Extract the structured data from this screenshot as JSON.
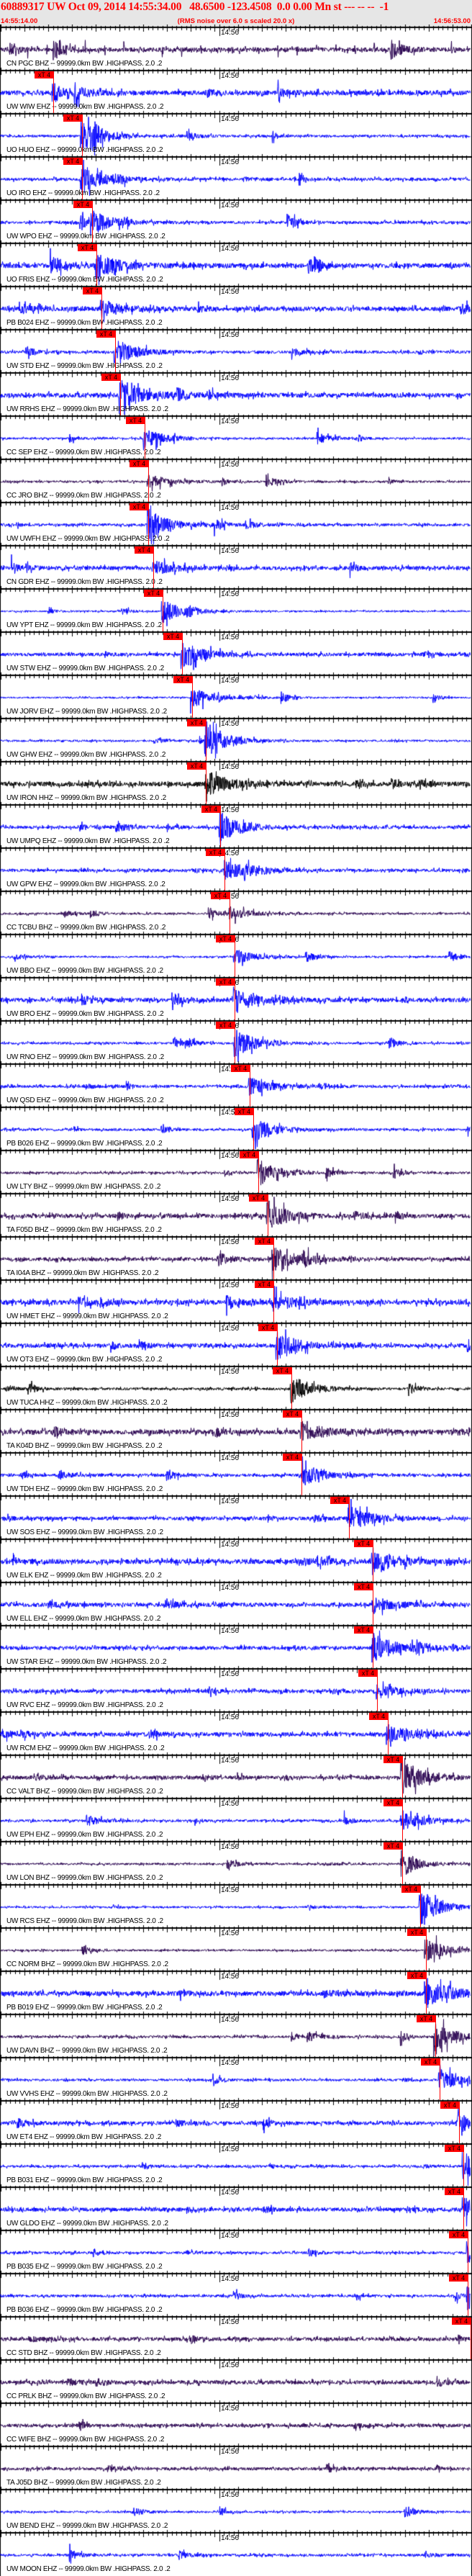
{
  "header": {
    "title": "60889317 UW Oct 09, 2014 14:55:34.00   48.6500 -123.4508  0.0 0.00 Mn st --- -- --  -1",
    "start_time": "14:55:14.00",
    "rms_note": "(RMS noise over 6.0 s scaled 20.0 x)",
    "end_time": "14:56:53.00"
  },
  "axis": {
    "minute_label": "14:56",
    "minute_offset_s": 46,
    "duration_s": 99
  },
  "pick_label": "xT 4",
  "colors": {
    "EHZ": "#0000ff",
    "BHZ": "#28004f",
    "HHZ": "#000000",
    "pick": "#ff0000"
  },
  "traces": [
    {
      "label": "CN PGC BHZ -- 99999.0km BW .HIGHPASS. 2.0 .2",
      "ch": "BHZ",
      "pick_s": null
    },
    {
      "label": "UW WIW EHZ -- 99999.0km BW .HIGHPASS. 2.0 .2",
      "ch": "EHZ",
      "pick_s": 11.1
    },
    {
      "label": "UO HUO EHZ -- 99999.0km BW .HIGHPASS. 2.0 .2",
      "ch": "EHZ",
      "pick_s": 17.1
    },
    {
      "label": "UO IRO EHZ -- 99999.0km BW .HIGHPASS. 2.0 .2",
      "ch": "EHZ",
      "pick_s": 17.1
    },
    {
      "label": "UW WPO EHZ -- 99999.0km BW .HIGHPASS. 2.0 .2",
      "ch": "EHZ",
      "pick_s": 19.2
    },
    {
      "label": "UO FRIS EHZ -- 99999.0km BW .HIGHPASS. 2.0 .2",
      "ch": "EHZ",
      "pick_s": 20.2
    },
    {
      "label": "PB B024 EHZ -- 99999.0km BW .HIGHPASS. 2.0 .2",
      "ch": "EHZ",
      "pick_s": 21.2
    },
    {
      "label": "UW STD EHZ -- 99999.0km BW .HIGHPASS. 2.0 .2",
      "ch": "EHZ",
      "pick_s": 24.1
    },
    {
      "label": "UW RRHS EHZ -- 99999.0km BW .HIGHPASS. 2.0 .2",
      "ch": "EHZ",
      "pick_s": 25.2
    },
    {
      "label": "CC SEP EHZ -- 99999.0km BW .HIGHPASS. 2.0 .2",
      "ch": "EHZ",
      "pick_s": 30.2
    },
    {
      "label": "CC JRO BHZ -- 99999.0km BW .HIGHPASS. 2.0 .2",
      "ch": "BHZ",
      "pick_s": 31.1
    },
    {
      "label": "UW UWFH EHZ -- 99999.0km BW .HIGHPASS. 2.0 .2",
      "ch": "EHZ",
      "pick_s": 31.1
    },
    {
      "label": "CN GDR EHZ -- 99999.0km BW .HIGHPASS. 2.0 .2",
      "ch": "EHZ",
      "pick_s": 32.1
    },
    {
      "label": "UW YPT EHZ -- 99999.0km BW .HIGHPASS. 2.0 .2",
      "ch": "EHZ",
      "pick_s": 34.1
    },
    {
      "label": "UW STW EHZ -- 99999.0km BW .HIGHPASS. 2.0 .2",
      "ch": "EHZ",
      "pick_s": 38.2
    },
    {
      "label": "UW JORV EHZ -- 99999.0km BW .HIGHPASS. 2.0 .2",
      "ch": "EHZ",
      "pick_s": 40.2
    },
    {
      "label": "UW GHW EHZ -- 99999.0km BW .HIGHPASS. 2.0 .2",
      "ch": "EHZ",
      "pick_s": 43.2
    },
    {
      "label": "UW IRON HHZ -- 99999.0km BW .HIGHPASS. 2.0 .2",
      "ch": "HHZ",
      "pick_s": 43.2
    },
    {
      "label": "UW UMPQ EHZ -- 99999.0km BW .HIGHPASS. 2.0 .2",
      "ch": "EHZ",
      "pick_s": 46.2
    },
    {
      "label": "UW GPW EHZ -- 99999.0km BW .HIGHPASS. 2.0 .2",
      "ch": "EHZ",
      "pick_s": 47.1
    },
    {
      "label": "CC TCBU BHZ -- 99999.0km BW .HIGHPASS. 2.0 .2",
      "ch": "BHZ",
      "pick_s": 48.2
    },
    {
      "label": "UW BBO EHZ -- 99999.0km BW .HIGHPASS. 2.0 .2",
      "ch": "EHZ",
      "pick_s": 49.2
    },
    {
      "label": "UW BRO EHZ -- 99999.0km BW .HIGHPASS. 2.0 .2",
      "ch": "EHZ",
      "pick_s": 49.2
    },
    {
      "label": "UW RNO EHZ -- 99999.0km BW .HIGHPASS. 2.0 .2",
      "ch": "EHZ",
      "pick_s": 49.2
    },
    {
      "label": "UW QSD EHZ -- 99999.0km BW .HIGHPASS. 2.0 .2",
      "ch": "EHZ",
      "pick_s": 52.4
    },
    {
      "label": "PB B026 EHZ -- 99999.0km BW .HIGHPASS. 2.0 .2",
      "ch": "EHZ",
      "pick_s": 53.2
    },
    {
      "label": "UW LTY BHZ -- 99999.0km BW .HIGHPASS. 2.0 .2",
      "ch": "BHZ",
      "pick_s": 54.2
    },
    {
      "label": "TA F05D BHZ -- 99999.0km BW .HIGHPASS. 2.0 .2",
      "ch": "BHZ",
      "pick_s": 56.2
    },
    {
      "label": "TA I04A BHZ -- 99999.0km BW .HIGHPASS. 2.0 .2",
      "ch": "BHZ",
      "pick_s": 57.3
    },
    {
      "label": "UW HMET EHZ -- 99999.0km BW .HIGHPASS. 2.0 .2",
      "ch": "EHZ",
      "pick_s": 57.3
    },
    {
      "label": "UW OT3 EHZ -- 99999.0km BW .HIGHPASS. 2.0 .2",
      "ch": "EHZ",
      "pick_s": 58.2
    },
    {
      "label": "UW TUCA HHZ -- 99999.0km BW .HIGHPASS. 2.0 .2",
      "ch": "HHZ",
      "pick_s": 61.2
    },
    {
      "label": "TA K04D BHZ -- 99999.0km BW .HIGHPASS. 2.0 .2",
      "ch": "BHZ",
      "pick_s": 63.2
    },
    {
      "label": "UW TDH EHZ -- 99999.0km BW .HIGHPASS. 2.0 .2",
      "ch": "EHZ",
      "pick_s": 63.2
    },
    {
      "label": "UW SOS EHZ -- 99999.0km BW .HIGHPASS. 2.0 .2",
      "ch": "EHZ",
      "pick_s": 73.3
    },
    {
      "label": "UW ELK EHZ -- 99999.0km BW .HIGHPASS. 2.0 .2",
      "ch": "EHZ",
      "pick_s": 78.3
    },
    {
      "label": "UW ELL EHZ -- 99999.0km BW .HIGHPASS. 2.0 .2",
      "ch": "EHZ",
      "pick_s": 78.3
    },
    {
      "label": "UW STAR EHZ -- 99999.0km BW .HIGHPASS. 2.0 .2",
      "ch": "EHZ",
      "pick_s": 78.3
    },
    {
      "label": "UW RVC EHZ -- 99999.0km BW .HIGHPASS. 2.0 .2",
      "ch": "EHZ",
      "pick_s": 79.2
    },
    {
      "label": "UW RCM EHZ -- 99999.0km BW .HIGHPASS. 2.0 .2",
      "ch": "EHZ",
      "pick_s": 81.4
    },
    {
      "label": "CC VALT BHZ -- 99999.0km BW .HIGHPASS. 2.0 .2",
      "ch": "BHZ",
      "pick_s": 84.4
    },
    {
      "label": "UW EPH EHZ -- 99999.0km BW .HIGHPASS. 2.0 .2",
      "ch": "EHZ",
      "pick_s": 84.4
    },
    {
      "label": "UW LON BHZ -- 99999.0km BW .HIGHPASS. 2.0 .2",
      "ch": "BHZ",
      "pick_s": 84.4
    },
    {
      "label": "UW RCS EHZ -- 99999.0km BW .HIGHPASS. 2.0 .2",
      "ch": "EHZ",
      "pick_s": 88.3
    },
    {
      "label": "CC NORM BHZ -- 99999.0km BW .HIGHPASS. 2.0 .2",
      "ch": "BHZ",
      "pick_s": 89.4
    },
    {
      "label": "PB B019 EHZ -- 99999.0km BW .HIGHPASS. 2.0 .2",
      "ch": "EHZ",
      "pick_s": 89.4
    },
    {
      "label": "UW DAVN BHZ -- 99999.0km BW .HIGHPASS. 2.0 .2",
      "ch": "BHZ",
      "pick_s": 91.4
    },
    {
      "label": "UW VVHS EHZ -- 99999.0km BW .HIGHPASS. 2.0 .2",
      "ch": "EHZ",
      "pick_s": 92.4
    },
    {
      "label": "UW ET4 EHZ -- 99999.0km BW .HIGHPASS. 2.0 .2",
      "ch": "EHZ",
      "pick_s": 96.4
    },
    {
      "label": "PB B031 EHZ -- 99999.0km BW .HIGHPASS. 2.0 .2",
      "ch": "EHZ",
      "pick_s": 97.4
    },
    {
      "label": "UW GLDO EHZ -- 99999.0km BW .HIGHPASS. 2.0 .2",
      "ch": "EHZ",
      "pick_s": 97.4
    },
    {
      "label": "PB B035 EHZ -- 99999.0km BW .HIGHPASS. 2.0 .2",
      "ch": "EHZ",
      "pick_s": 98.3
    },
    {
      "label": "PB B036 EHZ -- 99999.0km BW .HIGHPASS. 2.0 .2",
      "ch": "EHZ",
      "pick_s": 98.3
    },
    {
      "label": "CC STD BHZ -- 99999.0km BW .HIGHPASS. 2.0 .2",
      "ch": "BHZ",
      "pick_s": 99.4
    },
    {
      "label": "CC PRLK BHZ -- 99999.0km BW .HIGHPASS. 2.0 .2",
      "ch": "BHZ",
      "pick_s": null
    },
    {
      "label": "CC WIFE BHZ -- 99999.0km BW .HIGHPASS. 2.0 .2",
      "ch": "BHZ",
      "pick_s": null
    },
    {
      "label": "TA J05D BHZ -- 99999.0km BW .HIGHPASS. 2.0 .2",
      "ch": "BHZ",
      "pick_s": null
    },
    {
      "label": "UW BEND EHZ -- 99999.0km BW .HIGHPASS. 2.0 .2",
      "ch": "EHZ",
      "pick_s": null
    },
    {
      "label": "UW MOON EHZ -- 99999.0km BW .HIGHPASS. 2.0 .2",
      "ch": "EHZ",
      "pick_s": null
    }
  ]
}
